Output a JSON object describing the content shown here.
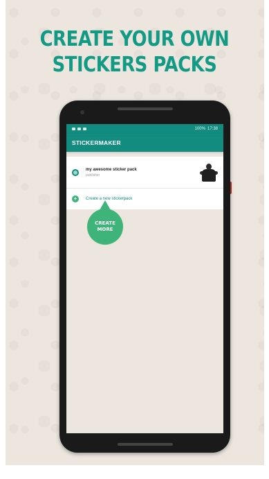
{
  "headline": {
    "line1": "CREATE YOUR OWN",
    "line2": "STICKERS PACKS"
  },
  "status_bar": {
    "battery": "100%",
    "time": "17:38"
  },
  "app_bar": {
    "title": "STICKERMAKER"
  },
  "sticker_packs": [
    {
      "name": "my awesome sticker pack",
      "subtitle": "publisher"
    }
  ],
  "create_row": {
    "label": "Create a new stickerpack"
  },
  "bubble": {
    "line1": "CREATE",
    "line2": "MORE"
  },
  "colors": {
    "brand": "#128c7e",
    "accent": "#3fb47a",
    "headline": "#139a85"
  }
}
